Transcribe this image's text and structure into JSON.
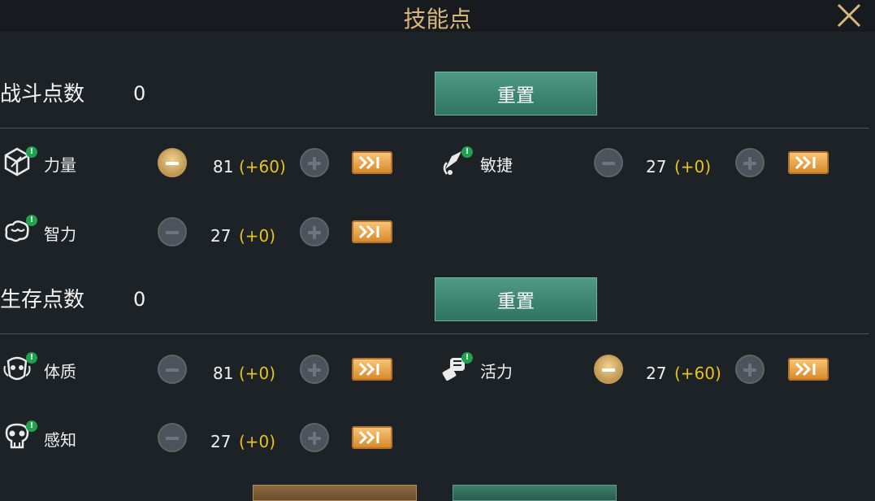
{
  "header": {
    "title": "技能点"
  },
  "sections": [
    {
      "label": "战斗点数",
      "value": "0",
      "reset_label": "重置",
      "stats": [
        {
          "name": "力量",
          "value": "81",
          "bonus": "(+60)",
          "icon": "strength-cube-icon",
          "minus_active": true
        },
        {
          "name": "敏捷",
          "value": "27",
          "bonus": "(+0)",
          "icon": "agility-icon",
          "minus_active": false
        },
        {
          "name": "智力",
          "value": "27",
          "bonus": "(+0)",
          "icon": "brain-icon",
          "minus_active": false
        }
      ]
    },
    {
      "label": "生存点数",
      "value": "0",
      "reset_label": "重置",
      "stats": [
        {
          "name": "体质",
          "value": "81",
          "bonus": "(+0)",
          "icon": "constitution-icon",
          "minus_active": false
        },
        {
          "name": "活力",
          "value": "27",
          "bonus": "(+60)",
          "icon": "vitality-fist-icon",
          "minus_active": true
        },
        {
          "name": "感知",
          "value": "27",
          "bonus": "(+0)",
          "icon": "perception-skull-icon",
          "minus_active": false
        }
      ]
    }
  ],
  "colors": {
    "accent_gold": "#d9b77a",
    "bonus_yellow": "#e8c21d",
    "reset_green": "#3f8a75",
    "badge_green": "#1fa14d",
    "background": "#1d2227"
  },
  "icons": [
    "close-icon",
    "plus-icon",
    "minus-icon",
    "max-forward-icon",
    "alert-badge-icon"
  ]
}
